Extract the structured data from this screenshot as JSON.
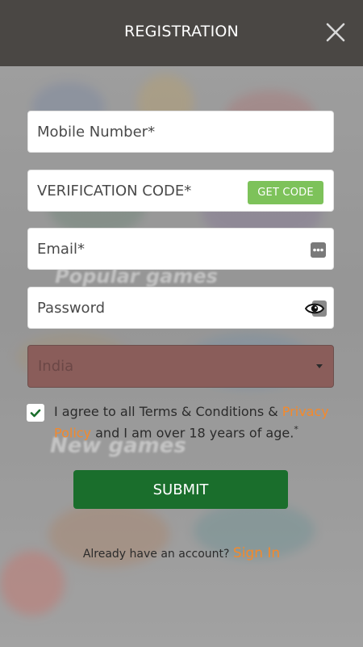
{
  "header": {
    "title": "REGISTRATION"
  },
  "background": {
    "ghost_texts": [
      "Popular games",
      "New games"
    ]
  },
  "form": {
    "mobile_placeholder": "Mobile Number*",
    "verification_placeholder": "VERIFICATION CODE*",
    "get_code_label": "GET CODE",
    "email_placeholder": "Email*",
    "password_placeholder": "Password",
    "country_value": "India",
    "agree_checked": true,
    "agree_text_1": "I agree to all Terms & Conditions & ",
    "agree_link": "Privacy Policy",
    "agree_text_2": " and I am over 18 years of age.",
    "agree_asterisk": "*",
    "submit_label": "SUBMIT"
  },
  "footer": {
    "already_text": "Already have an account? ",
    "signin_label": "Sign In"
  },
  "colors": {
    "header_bg": "#4a4744",
    "get_code_bg": "#7dc25a",
    "submit_bg": "#1a6e2c",
    "link": "#f5892a",
    "select_bg": "#8a5d5a",
    "checkmark": "#1a6e2c"
  }
}
